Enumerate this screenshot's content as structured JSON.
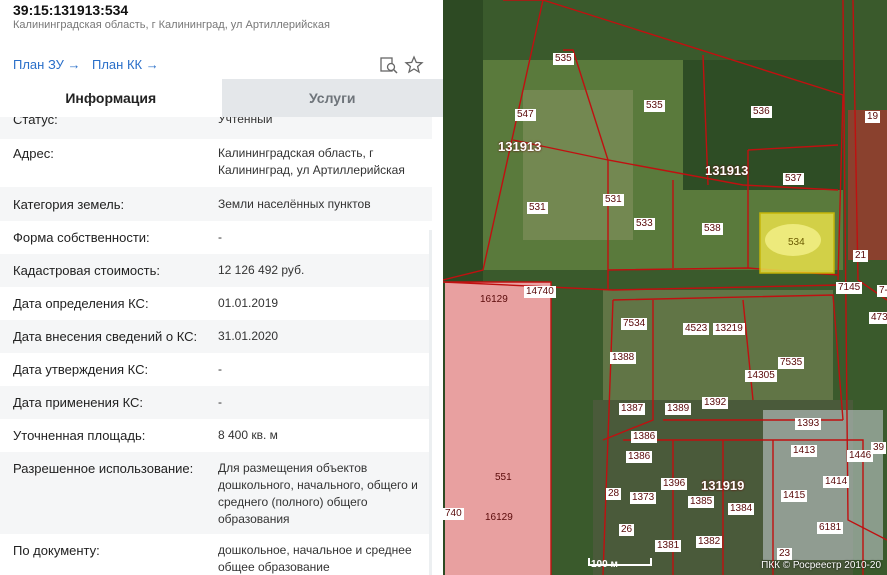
{
  "header": {
    "cad_number": "39:15:131913:534",
    "address": "Калининградская область, г Калининград, ул Артиллерийская"
  },
  "links": {
    "plan_zu": "План ЗУ →",
    "plan_kk": "План КК →"
  },
  "icons": {
    "search_doc": "document-search-icon",
    "favorite": "star-icon"
  },
  "tabs": [
    {
      "label": "Информация",
      "active": true
    },
    {
      "label": "Услуги",
      "active": false
    }
  ],
  "info_rows": [
    {
      "label": "Статус:",
      "value": "Учтенный"
    },
    {
      "label": "Адрес:",
      "value": "Калининградская область, г Калининград, ул Артиллерийская"
    },
    {
      "label": "Категория земель:",
      "value": "Земли населённых пунктов"
    },
    {
      "label": "Форма собственности:",
      "value": "-"
    },
    {
      "label": "Кадастровая стоимость:",
      "value": "12 126 492 руб."
    },
    {
      "label": "Дата определения КС:",
      "value": "01.01.2019"
    },
    {
      "label": "Дата внесения сведений о КС:",
      "value": "31.01.2020"
    },
    {
      "label": "Дата утверждения КС:",
      "value": "-"
    },
    {
      "label": "Дата применения КС:",
      "value": "-"
    },
    {
      "label": "Уточненная площадь:",
      "value": "8 400 кв. м"
    },
    {
      "label": "Разрешенное использование:",
      "value": "Для размещения объектов дошкольного, начального, общего и среднего (полного) общего образования"
    },
    {
      "label": "По документу:",
      "value": "дошкольное, начальное и среднее общее образование"
    }
  ],
  "map": {
    "selected_parcel": "534",
    "parcel_labels": [
      "535",
      "547",
      "535",
      "536",
      "19",
      "131913",
      "131913",
      "537",
      "531",
      "531",
      "533",
      "538",
      "534",
      "21",
      "7145",
      "16129",
      "14740",
      "7534",
      "4523",
      "13219",
      "7535",
      "1388",
      "14305",
      "1387",
      "1389",
      "1392",
      "1386",
      "1386",
      "1393",
      "1413",
      "1446",
      "131919",
      "28",
      "1373",
      "1396",
      "1385",
      "1384",
      "1415",
      "1414",
      "551",
      "740",
      "16129",
      "26",
      "1381",
      "1382",
      "6181",
      "23",
      "7-",
      "473",
      "39"
    ],
    "scale": "100 м",
    "copyright": "ПКК © Росреестр 2010-20"
  }
}
